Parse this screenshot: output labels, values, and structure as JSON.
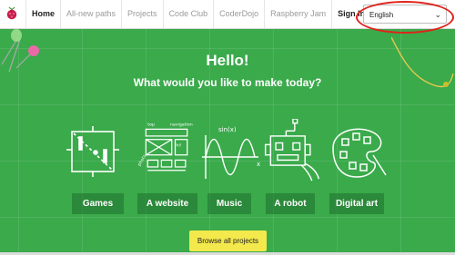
{
  "nav": {
    "items": [
      {
        "label": "Home",
        "state": "active"
      },
      {
        "label": "All-new paths",
        "state": "normal"
      },
      {
        "label": "Projects",
        "state": "normal"
      },
      {
        "label": "Code Club",
        "state": "normal"
      },
      {
        "label": "CoderDojo",
        "state": "normal"
      },
      {
        "label": "Raspberry Jam",
        "state": "normal"
      },
      {
        "label": "Sign In",
        "state": "strong"
      }
    ]
  },
  "language_select": {
    "value": "English"
  },
  "hero": {
    "title": "Hello!",
    "subtitle": "What would you like to make today?"
  },
  "categories": [
    {
      "label": "Games",
      "icon": "games-icon"
    },
    {
      "label": "A website",
      "icon": "website-icon"
    },
    {
      "label": "Music",
      "icon": "music-icon"
    },
    {
      "label": "A robot",
      "icon": "robot-icon"
    },
    {
      "label": "Digital art",
      "icon": "digital-art-icon"
    }
  ],
  "browse_button": {
    "label": "Browse all projects"
  },
  "illustration_text": {
    "website_top": "top",
    "website_nav": "navigation",
    "website_photo": "photo",
    "website_hi": "hi!",
    "music_formula": "sin(x)",
    "music_x": "x"
  },
  "colors": {
    "background": "#3aaa4b",
    "browse_button": "#f4e94c",
    "highlight_oval": "#e0231b",
    "logo": "#c51a4a"
  }
}
